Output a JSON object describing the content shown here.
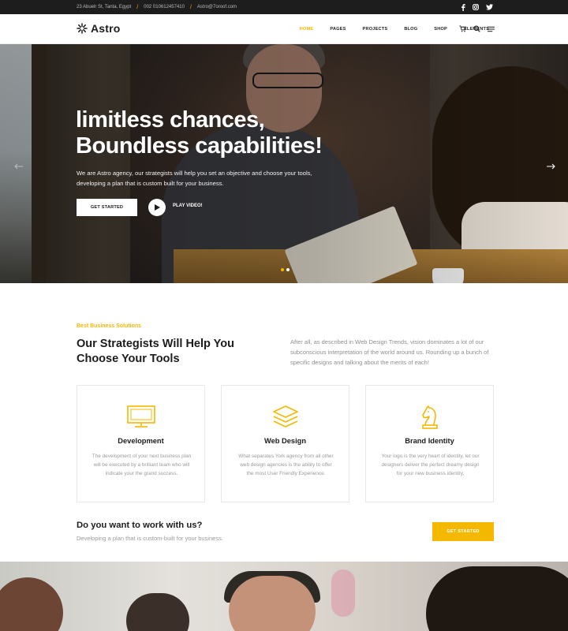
{
  "topbar": {
    "address": "23 Abuelr St, Tanta, Egypt",
    "phone": "002 010612457410",
    "email": "Astro@7oroof.com",
    "social": [
      "facebook-icon",
      "instagram-icon",
      "twitter-icon"
    ]
  },
  "header": {
    "logo_text": "Astro",
    "nav": [
      "HOME",
      "PAGES",
      "PROJECTS",
      "BLOG",
      "SHOP",
      "ELEMENTS"
    ],
    "active_nav": "HOME",
    "icons": [
      "cart-icon",
      "search-icon",
      "menu-icon"
    ]
  },
  "hero": {
    "title_line1": "limitless chances,",
    "title_line2": "Boundless capabilities!",
    "text": "We are Astro agency, our strategists will help you set an objective and choose your tools, developing a plan that is custom built for your business.",
    "primary_button": "GET STARTED",
    "video_label": "PLAY VIDEO!",
    "slides": 2,
    "active_slide": 1
  },
  "solutions": {
    "label": "Best Business Solutions",
    "title": "Our Strategists Will Help You Choose Your Tools",
    "description": "After all, as described in Web Design Trends, vision dominates a lot of our subconscious interpretation of the world around us. Rounding up a bunch of specific designs and talking about the merits of each!",
    "cards": [
      {
        "icon": "monitor-icon",
        "title": "Development",
        "text": "The development of your next business plan will be executed by a brilliant team who will indicate your the grand success."
      },
      {
        "icon": "layers-icon",
        "title": "Web Design",
        "text": "What separates York agency from all other web design agencies is the ability to offer the most User Friendly Experience."
      },
      {
        "icon": "chess-knight-icon",
        "title": "Brand Identity",
        "text": "Your logo is the very heart of identity, let our designers deliver the perfect dreamy design for your new business identity."
      }
    ]
  },
  "cta": {
    "title": "Do you want to work with us?",
    "text": "Developing a plan that is custom-built for your business.",
    "button": "GET STARTED"
  },
  "colors": {
    "accent": "#f5b800",
    "dark": "#1d1d1d",
    "text": "#1c1c1c",
    "muted": "#9a9a9a"
  }
}
